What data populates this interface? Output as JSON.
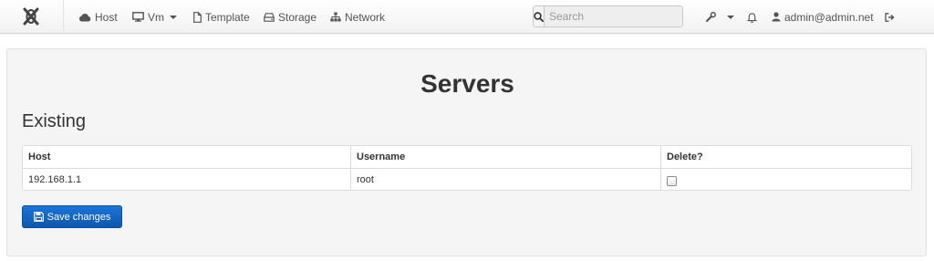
{
  "nav": {
    "items": [
      {
        "label": "Host",
        "icon": "cloud-icon"
      },
      {
        "label": "Vm",
        "icon": "monitor-icon",
        "dropdown": true
      },
      {
        "label": "Template",
        "icon": "file-icon"
      },
      {
        "label": "Storage",
        "icon": "hdd-icon"
      },
      {
        "label": "Network",
        "icon": "sitemap-icon"
      }
    ],
    "search_placeholder": "Search",
    "user": "admin@admin.net"
  },
  "main": {
    "title": "Servers",
    "section": "Existing",
    "table": {
      "headers": [
        "Host",
        "Username",
        "Delete?"
      ],
      "rows": [
        {
          "host": "192.168.1.1",
          "username": "root",
          "delete": false
        }
      ]
    },
    "save_label": "Save changes"
  },
  "colors": {
    "primary_button": "#1565c0",
    "navbar_bg": "#f7f7f7",
    "panel_bg": "#f5f5f5"
  }
}
